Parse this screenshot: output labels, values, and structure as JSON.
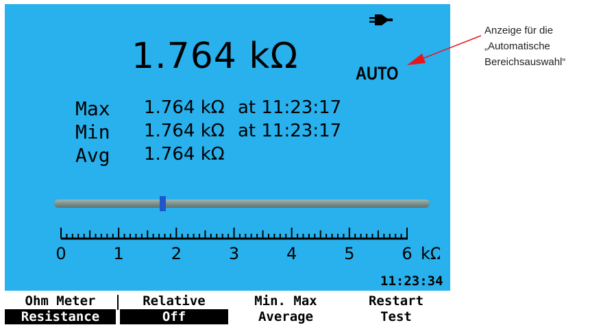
{
  "status": {
    "power_icon": "plug-icon",
    "range_mode": "AUTO",
    "time": "11:23:34"
  },
  "reading": {
    "main": "1.764 kΩ"
  },
  "stats": [
    {
      "label": "Max",
      "value": "1.764 kΩ",
      "time": "at 11:23:17"
    },
    {
      "label": "Min",
      "value": "1.764 kΩ",
      "time": "at 11:23:17"
    },
    {
      "label": "Avg",
      "value": "1.764 kΩ",
      "time": ""
    }
  ],
  "bargraph": {
    "min": 0,
    "max": 6,
    "value": 1.764,
    "unit": "kΩ",
    "tick_labels": [
      "0",
      "1",
      "2",
      "3",
      "4",
      "5",
      "6"
    ]
  },
  "softkeys": [
    {
      "top": "Ohm Meter",
      "bottom": "Resistance",
      "inverted": true
    },
    {
      "top": "Relative",
      "bottom": "Off",
      "inverted": true
    },
    {
      "top": "Min. Max",
      "bottom": "Average",
      "inverted": false
    },
    {
      "top": "Restart",
      "bottom": "Test",
      "inverted": false
    }
  ],
  "annotation": {
    "line1": "Anzeige für die",
    "line2": "„Automatische",
    "line3": "Bereichsauswahl“"
  },
  "colors": {
    "screen": "#28b1ec",
    "marker": "#1d57c8",
    "arrow": "#e8161b"
  }
}
